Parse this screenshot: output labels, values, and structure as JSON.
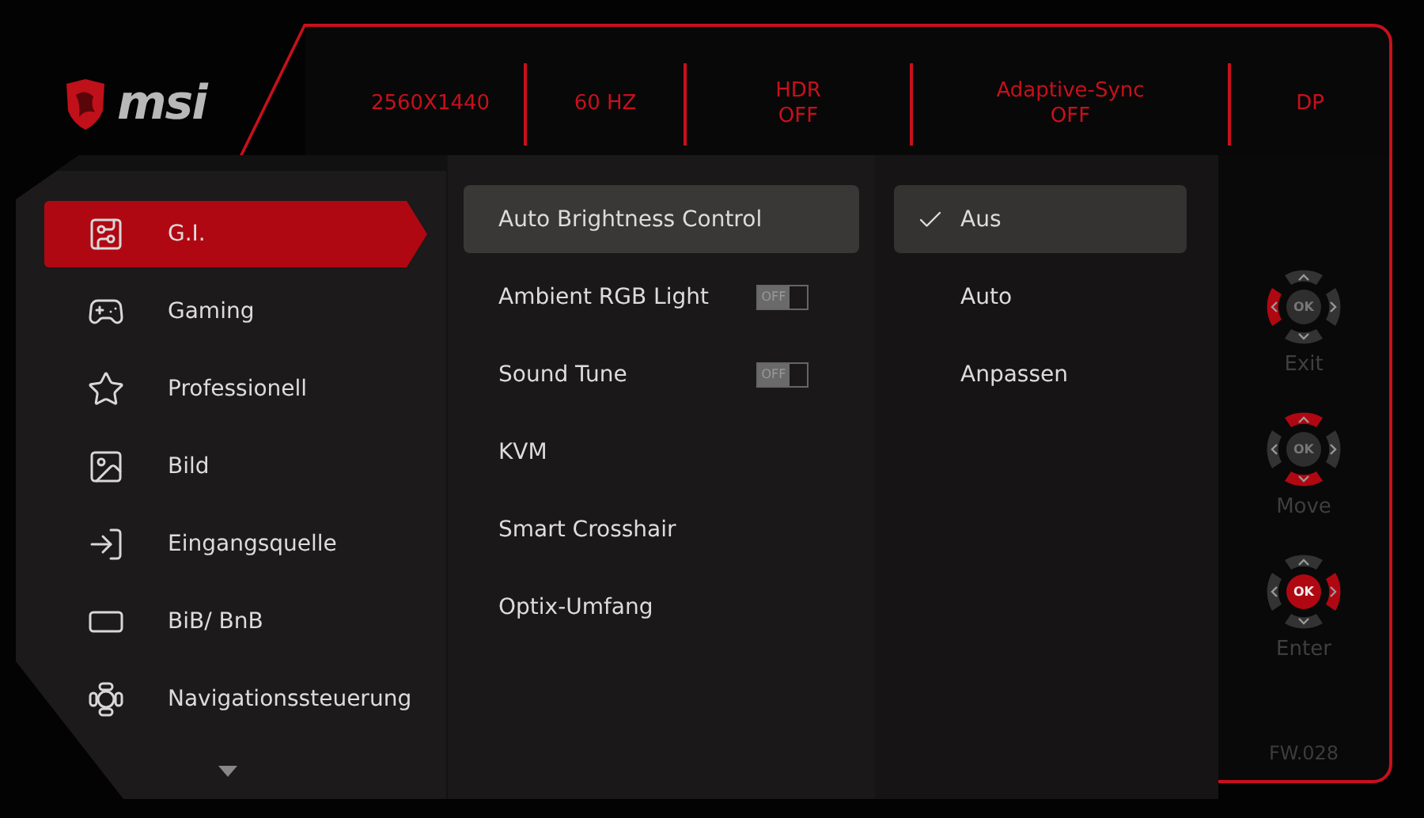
{
  "brand": "msi",
  "status": [
    {
      "label": "2560X1440"
    },
    {
      "label": "60 HZ"
    },
    {
      "label": "HDR",
      "value": "OFF"
    },
    {
      "label": "Adaptive-Sync",
      "value": "OFF"
    },
    {
      "label": "DP"
    }
  ],
  "sidebar": {
    "items": [
      {
        "label": "G.I.",
        "selected": true
      },
      {
        "label": "Gaming",
        "selected": false
      },
      {
        "label": "Professionell",
        "selected": false
      },
      {
        "label": "Bild",
        "selected": false
      },
      {
        "label": "Eingangsquelle",
        "selected": false
      },
      {
        "label": "BiB/ BnB",
        "selected": false
      },
      {
        "label": "Navigationssteuerung",
        "selected": false
      }
    ]
  },
  "settings": [
    {
      "label": "Auto Brightness Control",
      "kind": "submenu",
      "selected": true
    },
    {
      "label": "Ambient RGB Light",
      "kind": "toggle",
      "selected": false,
      "toggle_text": "OFF"
    },
    {
      "label": "Sound Tune",
      "kind": "toggle",
      "selected": false,
      "toggle_text": "OFF"
    },
    {
      "label": "KVM",
      "kind": "submenu",
      "selected": false
    },
    {
      "label": "Smart Crosshair",
      "kind": "submenu",
      "selected": false
    },
    {
      "label": "Optix-Umfang",
      "kind": "submenu",
      "selected": false
    }
  ],
  "options": [
    {
      "label": "Aus",
      "selected": true,
      "checked": true
    },
    {
      "label": "Auto",
      "selected": false,
      "checked": false
    },
    {
      "label": "Anpassen",
      "selected": false,
      "checked": false
    }
  ],
  "legend": [
    {
      "label": "Exit",
      "ok_label": "OK",
      "up_active": false,
      "down_active": false,
      "left_active": true,
      "right_active": false,
      "ok_active": false
    },
    {
      "label": "Move",
      "ok_label": "OK",
      "up_active": true,
      "down_active": true,
      "left_active": false,
      "right_active": false,
      "ok_active": false
    },
    {
      "label": "Enter",
      "ok_label": "OK",
      "up_active": false,
      "down_active": false,
      "left_active": false,
      "right_active": true,
      "ok_active": true
    }
  ],
  "firmware": "FW.028"
}
